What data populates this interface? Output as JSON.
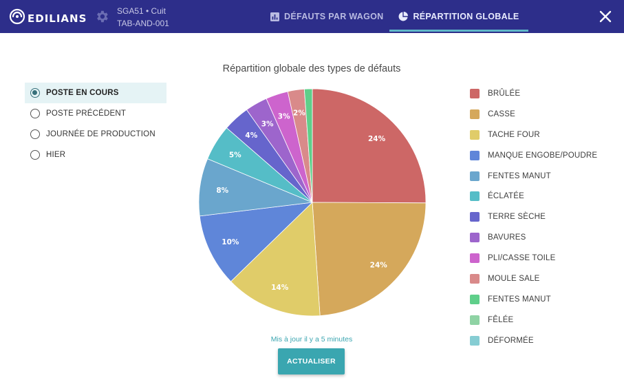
{
  "header": {
    "logo_text": "EDILIANS",
    "station_line1": "SGA51 • Cuit",
    "station_line2": "TAB-AND-001",
    "tabs": [
      {
        "label": "DÉFAUTS PAR WAGON",
        "icon": "bar-chart-icon",
        "active": false
      },
      {
        "label": "RÉPARTITION GLOBALE",
        "icon": "pie-chart-icon",
        "active": true
      }
    ],
    "colors": {
      "bar": "#2d2e8a",
      "accent": "#5fb8c8"
    }
  },
  "period_options": [
    {
      "label": "POSTE EN COURS",
      "selected": true
    },
    {
      "label": "POSTE PRÉCÉDENT",
      "selected": false
    },
    {
      "label": "JOURNÉE DE PRODUCTION",
      "selected": false
    },
    {
      "label": "HIER",
      "selected": false
    }
  ],
  "chart_data": {
    "type": "pie",
    "title": "Répartition globale des types de défauts",
    "categories": [
      "BRÛLÉE",
      "CASSE",
      "TACHE FOUR",
      "MANQUE ENGOBE/POUDRE",
      "FENTES MANUT",
      "ÉCLATÉE",
      "TERRE SÈCHE",
      "BAVURES",
      "PLI/CASSE TOILE",
      "MOULE SALE",
      "FENTES MANUT",
      "FÊLÉE",
      "DÉFORMÉE"
    ],
    "values": [
      24.5,
      23.3,
      13.5,
      10.1,
      8.0,
      5.0,
      3.7,
      3.1,
      3.1,
      2.3,
      1.1,
      0,
      0
    ],
    "labels": [
      "24%",
      "24%",
      "14%",
      "10%",
      "8%",
      "5%",
      "4%",
      "3%",
      "3%",
      "2%",
      "",
      "",
      ""
    ],
    "colors": [
      "#cd6766",
      "#d5a85b",
      "#e0cc69",
      "#5f86d9",
      "#6aa6cd",
      "#55bdc7",
      "#6665cc",
      "#9d65cc",
      "#cd64cd",
      "#d98a8a",
      "#5fcf8a",
      "#8fd3a4",
      "#86cdd3"
    ],
    "legend_position": "right"
  },
  "footer": {
    "updated_text": "Mis à jour il y a 5 minutes",
    "refresh_label": "ACTUALISER"
  }
}
